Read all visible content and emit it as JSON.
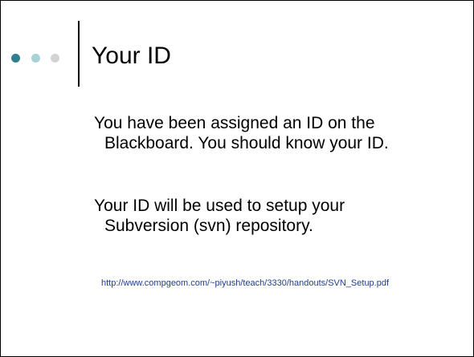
{
  "slide": {
    "title": "Your ID",
    "bullets": [
      {
        "line1": "You have been assigned an ID on the",
        "line2": "Blackboard. You should know your ID."
      },
      {
        "line1": "Your ID will be used to setup your",
        "line2": "Subversion (svn) repository."
      }
    ],
    "link_text": "http://www.compgeom.com/~piyush/teach/3330/handouts/SVN_Setup.pdf"
  },
  "theme": {
    "dot_colors": [
      "#2f7f8e",
      "#a9d2d8",
      "#d3d3d3"
    ],
    "link_color": "#1f3f8c"
  }
}
